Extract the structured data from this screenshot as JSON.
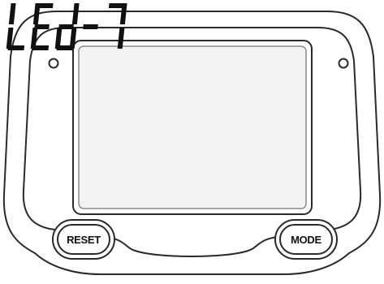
{
  "display": {
    "readout": "LEd-7",
    "characters": [
      "L",
      "E",
      "d",
      "-",
      "7"
    ]
  },
  "buttons": {
    "reset_label": "RESET",
    "mode_label": "MODE"
  },
  "colors": {
    "outline": "#2a2a2a",
    "screen_fill": "#f3f3f3",
    "background": "#ffffff"
  }
}
